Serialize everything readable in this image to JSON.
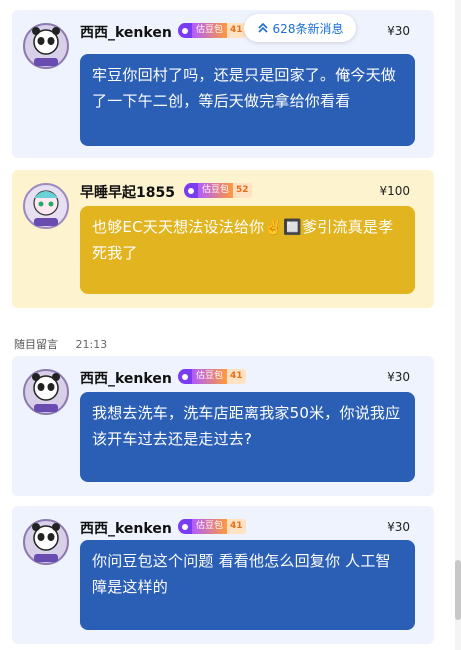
{
  "new_messages": {
    "label": "628条新消息",
    "icon": "double-chevron-up-icon"
  },
  "badge": {
    "text": "估豆包",
    "accent": "#7a3cf0"
  },
  "separator": {
    "author": "随目留言",
    "time": "21:13"
  },
  "messages": [
    {
      "author": "西西_kenken",
      "badge_level": "41",
      "price": "¥30",
      "text": "牢豆你回村了吗，还是只是回家了。俺今天做了一下午二创，等后天做完拿给你看看",
      "bubble_color": "#2a5fb5"
    },
    {
      "author": "早睡早起1855",
      "badge_level": "52",
      "price": "¥100",
      "text": "也够EC天天想法设法给你✌️🔲爹引流真是孝死我了",
      "bubble_color": "#e2b41f"
    },
    {
      "author": "西西_kenken",
      "badge_level": "41",
      "price": "¥30",
      "text": "我想去洗车，洗车店距离我家50米，你说我应该开车过去还是走过去?",
      "bubble_color": "#2a5fb5"
    },
    {
      "author": "西西_kenken",
      "badge_level": "41",
      "price": "¥30",
      "text": "你问豆包这个问题 看看他怎么回复你 人工智障是这样的",
      "bubble_color": "#2a5fb5"
    }
  ]
}
